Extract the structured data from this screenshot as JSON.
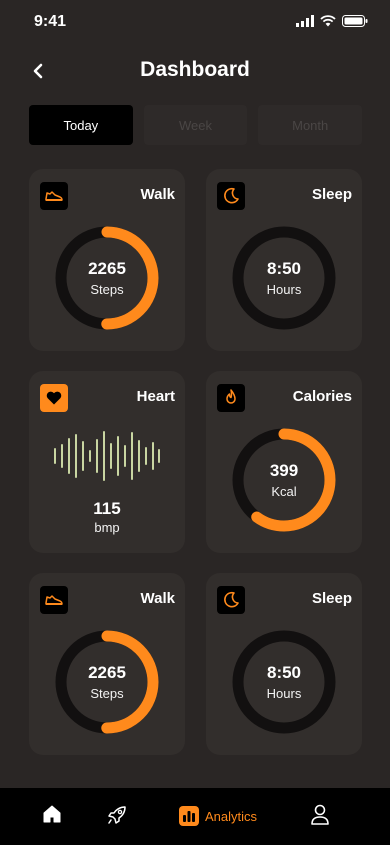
{
  "status_bar": {
    "time": "9:41"
  },
  "header": {
    "title": "Dashboard",
    "back_icon": "chevron-left-icon"
  },
  "tabs": [
    {
      "label": "Today",
      "active": true
    },
    {
      "label": "Week",
      "active": false
    },
    {
      "label": "Month",
      "active": false
    }
  ],
  "colors": {
    "accent": "#ff8a1c",
    "background": "#2a2625",
    "card": "#322e2c",
    "ring_track": "#121010",
    "wave": "#c9d6a2"
  },
  "cards": {
    "walk1": {
      "title": "Walk",
      "icon": "shoe-icon",
      "value": "2265",
      "unit": "Steps",
      "progress": 0.5
    },
    "sleep1": {
      "title": "Sleep",
      "icon": "moon-icon",
      "value": "8:50",
      "unit": "Hours",
      "progress": 0
    },
    "heart": {
      "title": "Heart",
      "icon": "heart-icon",
      "value": "115",
      "unit": "bmp"
    },
    "calories": {
      "title": "Calories",
      "icon": "flame-icon",
      "value": "399",
      "unit": "Kcal",
      "progress": 0.6
    },
    "walk2": {
      "title": "Walk",
      "icon": "shoe-icon",
      "value": "2265",
      "unit": "Steps",
      "progress": 0.5
    },
    "sleep2": {
      "title": "Sleep",
      "icon": "moon-icon",
      "value": "8:50",
      "unit": "Hours",
      "progress": 0
    }
  },
  "bottom_nav": {
    "home_icon": "home-icon",
    "explore_icon": "rocket-icon",
    "analytics_label": "Analytics",
    "analytics_icon": "analytics-icon",
    "profile_icon": "user-icon"
  }
}
